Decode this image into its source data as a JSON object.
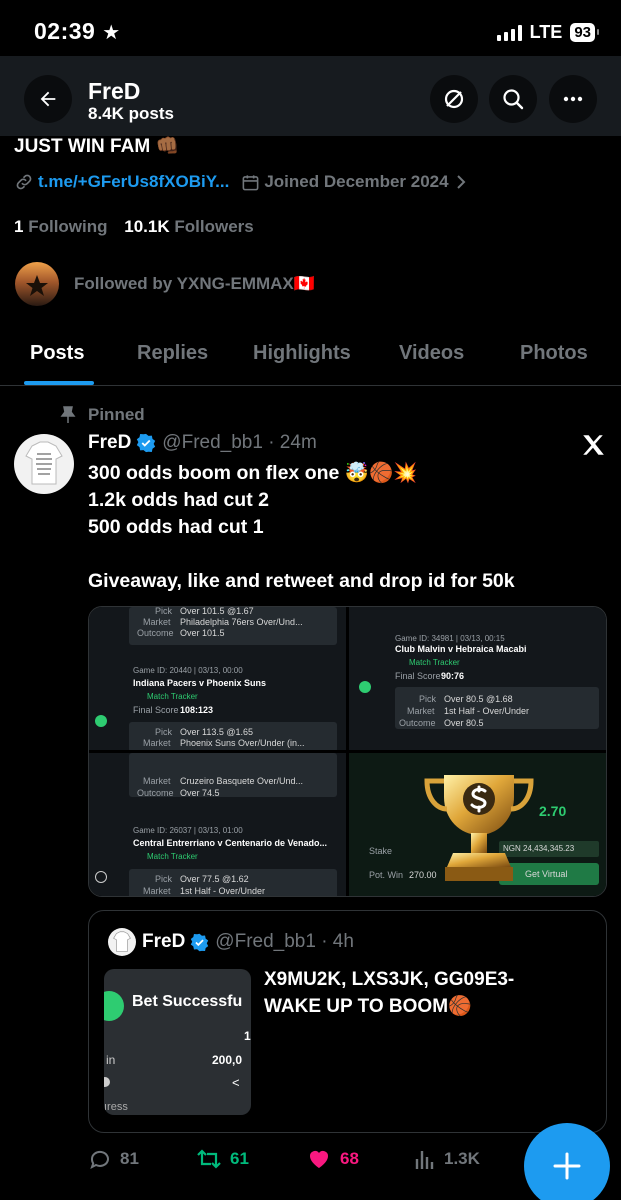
{
  "status": {
    "time": "02:39",
    "network": "LTE",
    "battery": "93"
  },
  "header": {
    "name": "FreD",
    "posts": "8.4K posts"
  },
  "profile": {
    "bio": "JUST WIN FAM 👊🏾",
    "link": "t.me/+GFerUs8fXOBiY...",
    "joined": "Joined December 2024",
    "following_count": "1",
    "following_label": "Following",
    "followers_count": "10.1K",
    "followers_label": "Followers",
    "followed_by": "Followed by YXNG-EMMAX🇨🇦"
  },
  "tabs": [
    "Posts",
    "Replies",
    "Highlights",
    "Videos",
    "Photos"
  ],
  "post": {
    "pinned_label": "Pinned",
    "author": "FreD",
    "handle": "@Fred_bb1 · 24m",
    "avatar_text": "im busy becoming everything i prayed for",
    "lines": [
      "300 odds boom on flex one 🤯🏀💥",
      "1.2k odds had cut 2",
      "500 odds had cut 1",
      "",
      "Giveaway, like and retweet and drop id for 50k"
    ],
    "media": {
      "tl": {
        "pick": "Over 101.5 @1.67",
        "market": "Philadelphia 76ers Over/Und...",
        "outcome": "Over 101.5",
        "game": "Game ID: 20440 | 03/13, 00:00",
        "teams": "Indiana Pacers v Phoenix Suns",
        "tracker": "Match Tracker",
        "score_label": "Final Score",
        "score": "108:123",
        "pick2": "Over 113.5 @1.65",
        "market2": "Phoenix Suns Over/Under (in..."
      },
      "tr": {
        "game": "Game ID: 34981 | 03/13, 00:15",
        "teams": "Club Malvin v Hebraica Macabi",
        "tracker": "Match Tracker",
        "score_label": "Final Score",
        "score": "90:76",
        "pick": "Over 80.5 @1.68",
        "market": "1st Half - Over/Under",
        "outcome": "Over 80.5"
      },
      "bl": {
        "market": "Cruzeiro Basquete Over/Und...",
        "outcome": "Over 74.5",
        "game": "Game ID: 26037 | 03/13, 01:00",
        "teams": "Central Entrerriano v Centenario de Venado...",
        "tracker": "Match Tracker",
        "pick": "Over 77.5 @1.62",
        "market2": "1st Half - Over/Under"
      },
      "br": {
        "odds": "2.70",
        "stake_label": "Stake",
        "stake_value": "NGN 24,434,345.23",
        "potwin_label": "Pot. Win",
        "potwin_value": "270.00",
        "bet_label": "Get Virtual"
      }
    },
    "labels": {
      "pick": "Pick",
      "market": "Market",
      "outcome": "Outcome"
    }
  },
  "quote": {
    "author": "FreD",
    "handle": "@Fred_bb1 · 4h",
    "text_line1": "X9MU2K, LXS3JK, GG09E3-",
    "text_line2": "WAKE UP TO BOOM🏀",
    "img_title": "Bet Successfu",
    "img_val1": "1",
    "img_left": "in",
    "img_val2": "200,0",
    "img_bottom": "ıress"
  },
  "actions": {
    "replies": "81",
    "reposts": "61",
    "likes": "68",
    "views": "1.3K"
  },
  "colors": {
    "accent": "#1d9bf0",
    "repost": "#00ba7c",
    "like": "#f91880",
    "muted": "#71767b"
  }
}
